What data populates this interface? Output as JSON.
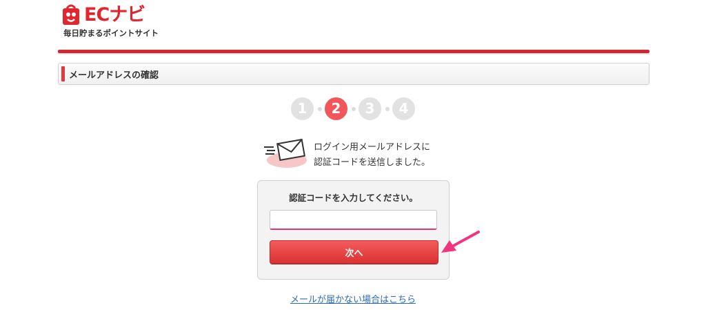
{
  "header": {
    "logo_text": "ECナビ",
    "tagline": "毎日貯まるポイントサイト"
  },
  "section": {
    "title": "メールアドレスの確認"
  },
  "stepper": {
    "steps": [
      "1",
      "2",
      "3",
      "4"
    ],
    "current": 2,
    "colors": {
      "active": "#f0565a",
      "inactive": "#e2e2e2"
    }
  },
  "message": {
    "line1": "ログイン用メールアドレスに",
    "line2": "認証コードを送信しました。"
  },
  "form": {
    "label": "認証コードを入力してください。",
    "code_value": "",
    "submit_label": "次へ"
  },
  "link": {
    "text": "メールが届かない場合はこちら"
  },
  "colors": {
    "brand": "#e0262f",
    "button": "#e03a3f",
    "link": "#2a6bb8",
    "annotation_arrow": "#f0357e"
  }
}
